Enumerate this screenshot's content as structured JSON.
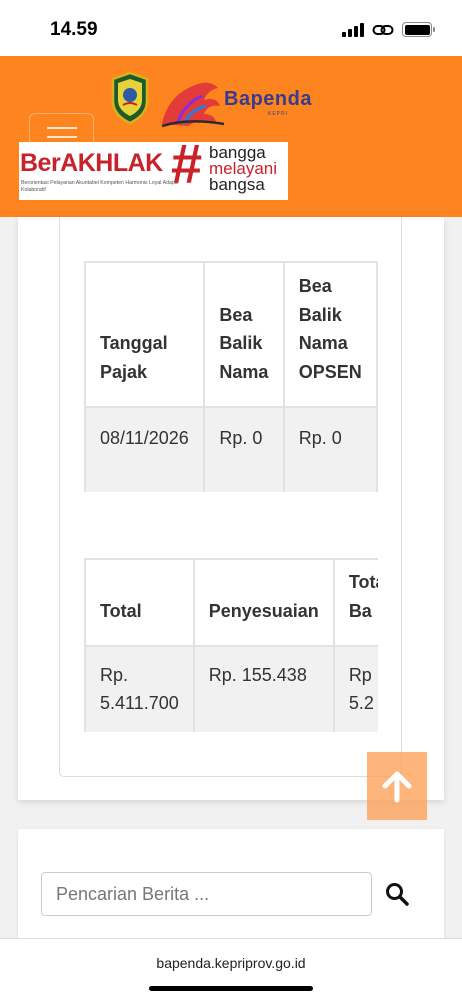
{
  "status_bar": {
    "time": "14.59"
  },
  "header": {
    "bapenda_logo_text": "Bapenda",
    "bapenda_logo_sub": "KEPRI",
    "banner": {
      "title": "BerAKHLAK",
      "subtitle": "Berorientasi Pelayanan Akuntabel Kompeten Harmonis Loyal Adaptif Kolaboratif",
      "hashtag": "#",
      "tagline_1": "bangga",
      "tagline_2": "melayani",
      "tagline_3": "bangsa"
    }
  },
  "table1": {
    "headers": [
      "Tanggal Pajak",
      "Bea Balik Nama",
      "Bea Balik Nama OPSEN"
    ],
    "rows": [
      [
        "08/11/2026",
        "Rp. 0",
        "Rp. 0"
      ]
    ]
  },
  "table2": {
    "headers": [
      "Total",
      "Penyesuaian",
      "Total Ba"
    ],
    "rows": [
      [
        "Rp. 5.411.700",
        "Rp. 155.438",
        "Rp 5.2"
      ]
    ]
  },
  "search": {
    "placeholder": "Pencarian Berita ..."
  },
  "browser": {
    "url": "bapenda.kepriprov.go.id"
  },
  "colors": {
    "header_orange": "#fd841f",
    "brand_red": "#c9222b",
    "brand_blue": "#3b3b8c"
  }
}
